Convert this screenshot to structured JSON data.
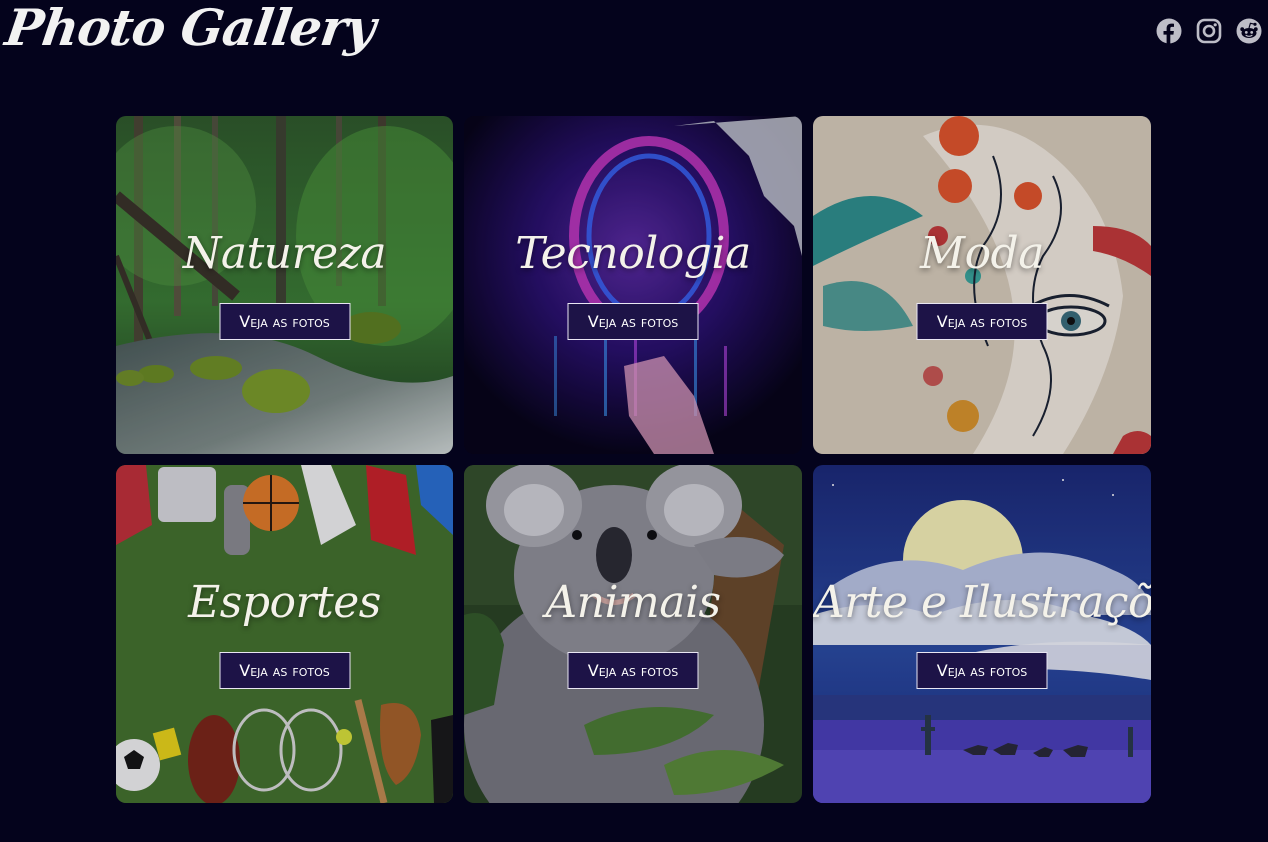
{
  "header": {
    "logo": "Photo Gallery",
    "social": [
      "facebook-icon",
      "instagram-icon",
      "reddit-icon"
    ]
  },
  "colors": {
    "background": "#04031c",
    "button_bg": "#1d1347",
    "button_border": "#e9e6f3",
    "icon": "#bdbdc7"
  },
  "gallery": {
    "cards": [
      {
        "title": "Natureza",
        "button": "Veja as fotos"
      },
      {
        "title": "Tecnologia",
        "button": "Veja as fotos"
      },
      {
        "title": "Moda",
        "button": "Veja as fotos"
      },
      {
        "title": "Esportes",
        "button": "Veja as fotos"
      },
      {
        "title": "Animais",
        "button": "Veja as fotos"
      },
      {
        "title": "Arte e Ilustrações",
        "button": "Veja as fotos"
      }
    ]
  }
}
